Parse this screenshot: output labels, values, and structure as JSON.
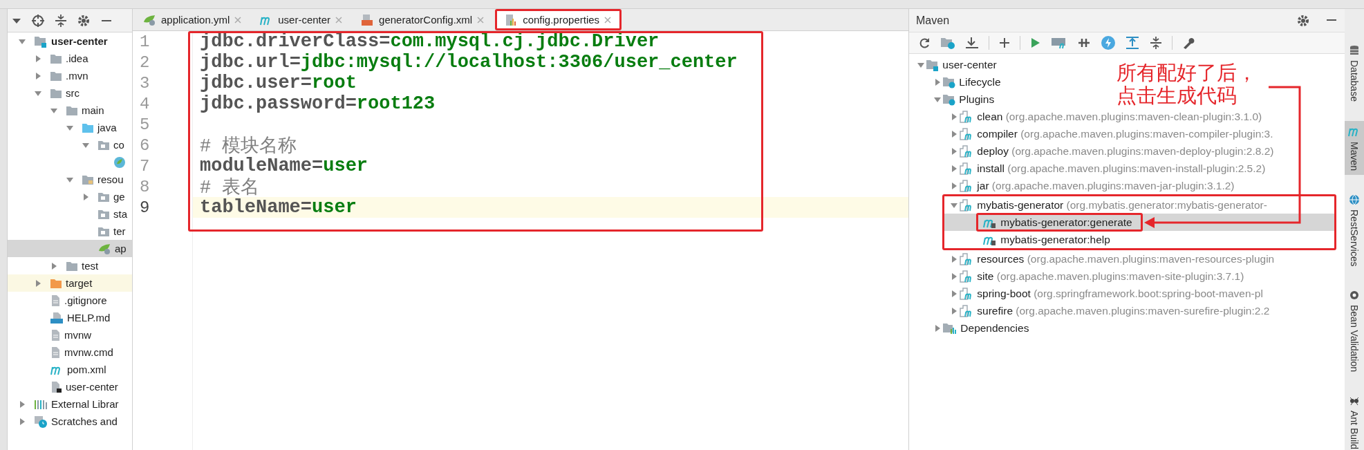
{
  "tabs": [
    {
      "label": "application.yml",
      "kind": "spring",
      "selected": false,
      "annotated": false
    },
    {
      "label": "user-center",
      "kind": "maven",
      "selected": false,
      "annotated": false
    },
    {
      "label": "generatorConfig.xml",
      "kind": "xml",
      "selected": false,
      "annotated": false
    },
    {
      "label": "config.properties",
      "kind": "properties",
      "selected": true,
      "annotated": true
    }
  ],
  "project_tree": [
    {
      "label": "user-center",
      "kind": "module",
      "bold": true,
      "expanded": true,
      "selected": false,
      "highlighted": false,
      "children": [
        {
          "label": ".idea",
          "kind": "folder",
          "expanded": false,
          "selected": false,
          "highlighted": false
        },
        {
          "label": ".mvn",
          "kind": "folder",
          "expanded": false,
          "selected": false,
          "highlighted": false
        },
        {
          "label": "src",
          "kind": "folder",
          "expanded": true,
          "selected": false,
          "highlighted": false,
          "children": [
            {
              "label": "main",
              "kind": "folder",
              "expanded": true,
              "selected": false,
              "highlighted": false,
              "children": [
                {
                  "label": "java",
                  "kind": "source-folder",
                  "expanded": true,
                  "selected": false,
                  "highlighted": false,
                  "children": [
                    {
                      "label": "co",
                      "kind": "package",
                      "expanded": true,
                      "selected": false,
                      "highlighted": false,
                      "children": [
                        {
                          "kind": "spring-class",
                          "selected": false,
                          "highlighted": false
                        }
                      ]
                    }
                  ]
                },
                {
                  "label": "resou",
                  "kind": "resources-folder",
                  "expanded": true,
                  "selected": false,
                  "highlighted": false,
                  "children": [
                    {
                      "label": "ge",
                      "kind": "package",
                      "expanded": false,
                      "selected": false,
                      "highlighted": false
                    },
                    {
                      "label": "sta",
                      "kind": "package",
                      "selected": false,
                      "highlighted": false
                    },
                    {
                      "label": "ter",
                      "kind": "package",
                      "selected": false,
                      "highlighted": false
                    },
                    {
                      "label": "ap",
                      "kind": "spring-config",
                      "selected": true,
                      "highlighted": false
                    }
                  ]
                }
              ]
            },
            {
              "label": "test",
              "kind": "folder",
              "expanded": false,
              "selected": false,
              "highlighted": false
            }
          ]
        },
        {
          "label": "target",
          "kind": "excluded-folder",
          "expanded": false,
          "selected": false,
          "highlighted": true
        },
        {
          "label": ".gitignore",
          "kind": "file",
          "selected": false,
          "highlighted": false
        },
        {
          "label": "HELP.md",
          "kind": "markdown",
          "selected": false,
          "highlighted": false
        },
        {
          "label": "mvnw",
          "kind": "file",
          "selected": false,
          "highlighted": false
        },
        {
          "label": "mvnw.cmd",
          "kind": "file",
          "selected": false,
          "highlighted": false
        },
        {
          "label": "pom.xml",
          "kind": "maven",
          "selected": false,
          "highlighted": false
        },
        {
          "label": "user-center",
          "kind": "module-file",
          "selected": false,
          "highlighted": false
        }
      ]
    },
    {
      "label": "External Librar",
      "kind": "libraries",
      "expanded": false,
      "selected": false,
      "highlighted": false
    },
    {
      "label": "Scratches and",
      "kind": "scratches",
      "expanded": false,
      "selected": false,
      "highlighted": false
    }
  ],
  "editor": {
    "annotated": true,
    "lines": [
      {
        "number": "1",
        "kind": "property",
        "key": "jdbc.driverClass",
        "separator": "=",
        "value": "com.mysql.cj.jdbc.Driver",
        "current": false
      },
      {
        "number": "2",
        "kind": "property",
        "key": "jdbc.url",
        "separator": "=",
        "value": "jdbc:mysql://localhost:3306/user_center",
        "current": false
      },
      {
        "number": "3",
        "kind": "property",
        "key": "jdbc.user",
        "separator": "=",
        "value": "root",
        "current": false
      },
      {
        "number": "4",
        "kind": "property",
        "key": "jdbc.password",
        "separator": "=",
        "value": "root123",
        "current": false
      },
      {
        "number": "5",
        "kind": "blank",
        "current": false
      },
      {
        "number": "6",
        "kind": "comment",
        "text": "# 模块名称",
        "current": false
      },
      {
        "number": "7",
        "kind": "property",
        "key": "moduleName",
        "separator": "=",
        "value": "user",
        "current": false
      },
      {
        "number": "8",
        "kind": "comment",
        "text": "# 表名",
        "current": false
      },
      {
        "number": "9",
        "kind": "property",
        "key": "tableName",
        "separator": "=",
        "value": "user",
        "current": true
      }
    ]
  },
  "maven": {
    "title": "Maven",
    "tree": [
      {
        "label": "user-center",
        "kind": "module",
        "expanded": true,
        "selected": false,
        "annotated": false,
        "children": [
          {
            "label": "Lifecycle",
            "kind": "lifecycle",
            "expanded": false,
            "selected": false,
            "annotated": false
          },
          {
            "label": "Plugins",
            "kind": "plugins",
            "expanded": true,
            "selected": false,
            "annotated": false,
            "children": [
              {
                "label": "clean",
                "detail": "(org.apache.maven.plugins:maven-clean-plugin:3.1.0)",
                "kind": "plugin",
                "expanded": false,
                "selected": false,
                "annotated": false
              },
              {
                "label": "compiler",
                "detail": "(org.apache.maven.plugins:maven-compiler-plugin:3.",
                "kind": "plugin",
                "expanded": false,
                "selected": false,
                "annotated": false
              },
              {
                "label": "deploy",
                "detail": "(org.apache.maven.plugins:maven-deploy-plugin:2.8.2)",
                "kind": "plugin",
                "expanded": false,
                "selected": false,
                "annotated": false
              },
              {
                "label": "install",
                "detail": "(org.apache.maven.plugins:maven-install-plugin:2.5.2)",
                "kind": "plugin",
                "expanded": false,
                "selected": false,
                "annotated": false
              },
              {
                "label": "jar",
                "detail": "(org.apache.maven.plugins:maven-jar-plugin:3.1.2)",
                "kind": "plugin",
                "expanded": false,
                "selected": false,
                "annotated": false
              },
              {
                "label": "mybatis-generator",
                "detail": "(org.mybatis.generator:mybatis-generator-",
                "kind": "plugin",
                "expanded": true,
                "selected": false,
                "annotated": true,
                "children": [
                  {
                    "label": "mybatis-generator:generate",
                    "kind": "goal",
                    "selected": true,
                    "annotated": true
                  },
                  {
                    "label": "mybatis-generator:help",
                    "kind": "goal",
                    "selected": false,
                    "annotated": false
                  }
                ]
              },
              {
                "label": "resources",
                "detail": "(org.apache.maven.plugins:maven-resources-plugin",
                "kind": "plugin",
                "expanded": false,
                "selected": false,
                "annotated": false
              },
              {
                "label": "site",
                "detail": "(org.apache.maven.plugins:maven-site-plugin:3.7.1)",
                "kind": "plugin",
                "expanded": false,
                "selected": false,
                "annotated": false
              },
              {
                "label": "spring-boot",
                "detail": "(org.springframework.boot:spring-boot-maven-pl",
                "kind": "plugin",
                "expanded": false,
                "selected": false,
                "annotated": false
              },
              {
                "label": "surefire",
                "detail": "(org.apache.maven.plugins:maven-surefire-plugin:2.2",
                "kind": "plugin",
                "expanded": false,
                "selected": false,
                "annotated": false
              }
            ]
          },
          {
            "label": "Dependencies",
            "kind": "dependencies",
            "expanded": false,
            "selected": false,
            "annotated": false
          }
        ]
      }
    ]
  },
  "callout": {
    "lines": [
      "所有配好了后，",
      "点击生成代码"
    ]
  },
  "side_tabs": [
    {
      "label": "Database",
      "kind": "database",
      "selected": false
    },
    {
      "label": "Maven",
      "kind": "maven",
      "selected": true
    },
    {
      "label": "RestServices",
      "kind": "rest",
      "selected": false
    },
    {
      "label": "Bean Validation",
      "kind": "bean",
      "selected": false
    },
    {
      "label": "Ant Build",
      "kind": "ant",
      "selected": false
    }
  ]
}
